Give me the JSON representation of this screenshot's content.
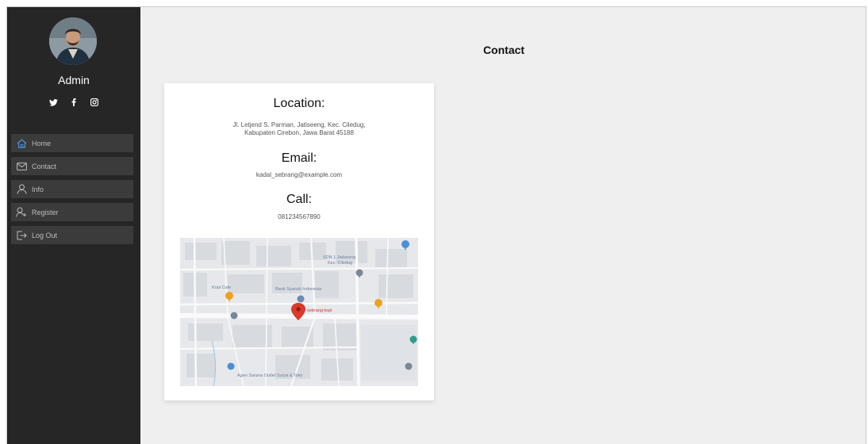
{
  "sidebar": {
    "user_name": "Admin",
    "socials": [
      "twitter-icon",
      "facebook-icon",
      "instagram-icon"
    ],
    "items": [
      {
        "label": "Home",
        "icon": "home-icon",
        "active": true
      },
      {
        "label": "Contact",
        "icon": "mail-icon"
      },
      {
        "label": "Info",
        "icon": "user-icon"
      },
      {
        "label": "Register",
        "icon": "add-user-icon"
      },
      {
        "label": "Log Out",
        "icon": "logout-icon"
      }
    ]
  },
  "main": {
    "title": "Contact",
    "location": {
      "heading": "Location:",
      "line1": "Jl. Letjend S. Parman, Jatiseeng, Kec. Ciledug,",
      "line2": "Kabupaten Cirebon, Jawa Barat 45188"
    },
    "email": {
      "heading": "Email:",
      "value": "kadal_sebrang@example.com"
    },
    "call": {
      "heading": "Call:",
      "value": "081234567890"
    },
    "map": {
      "labels": {
        "sdn": "SDN 1 Jatiseeng",
        "sdn_sub": "Kec. Ciledug",
        "bank": "Bank Syariah Indonesia",
        "cafe": "Kopi Cafe",
        "marker": "sebrang kopi",
        "bottom": "Agen Sarana Outlet Surya & Toko"
      }
    }
  },
  "colors": {
    "sidebar_bg": "#262626",
    "nav_item_bg": "#3b3b3b",
    "page_bg": "#efefef",
    "active_icon": "#4a8fd8"
  }
}
